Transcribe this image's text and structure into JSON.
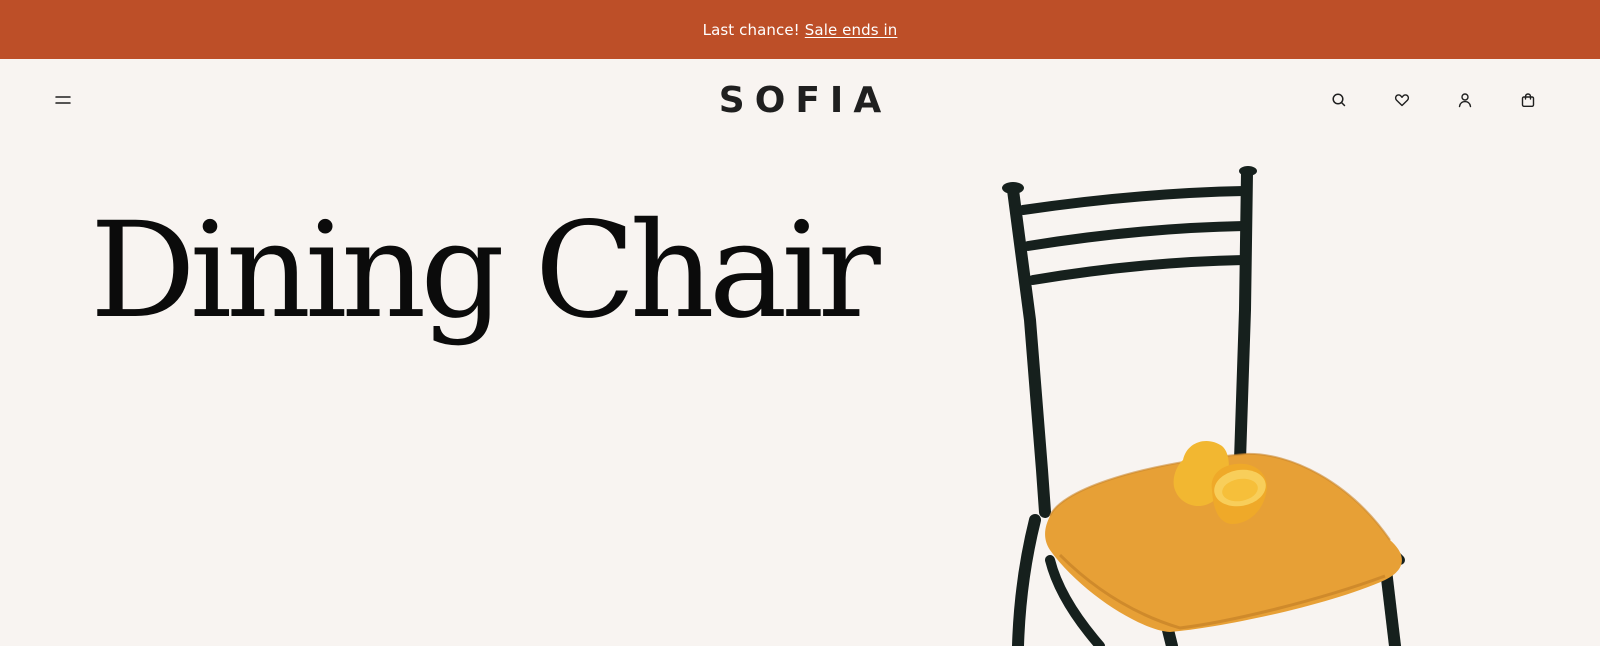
{
  "announcement": {
    "text": "Last chance!",
    "link_text": "Sale ends in"
  },
  "header": {
    "logo": "SOFIA",
    "icons": [
      "menu-icon",
      "search-icon",
      "heart-icon",
      "user-icon",
      "bag-icon"
    ]
  },
  "hero": {
    "title": "Dining Chair"
  },
  "colors": {
    "announcement_bg": "#bd4f28",
    "page_bg": "#f8f4f1",
    "text": "#1f1f1f",
    "seat": "#e7a036",
    "fruit": "#f2b731"
  }
}
